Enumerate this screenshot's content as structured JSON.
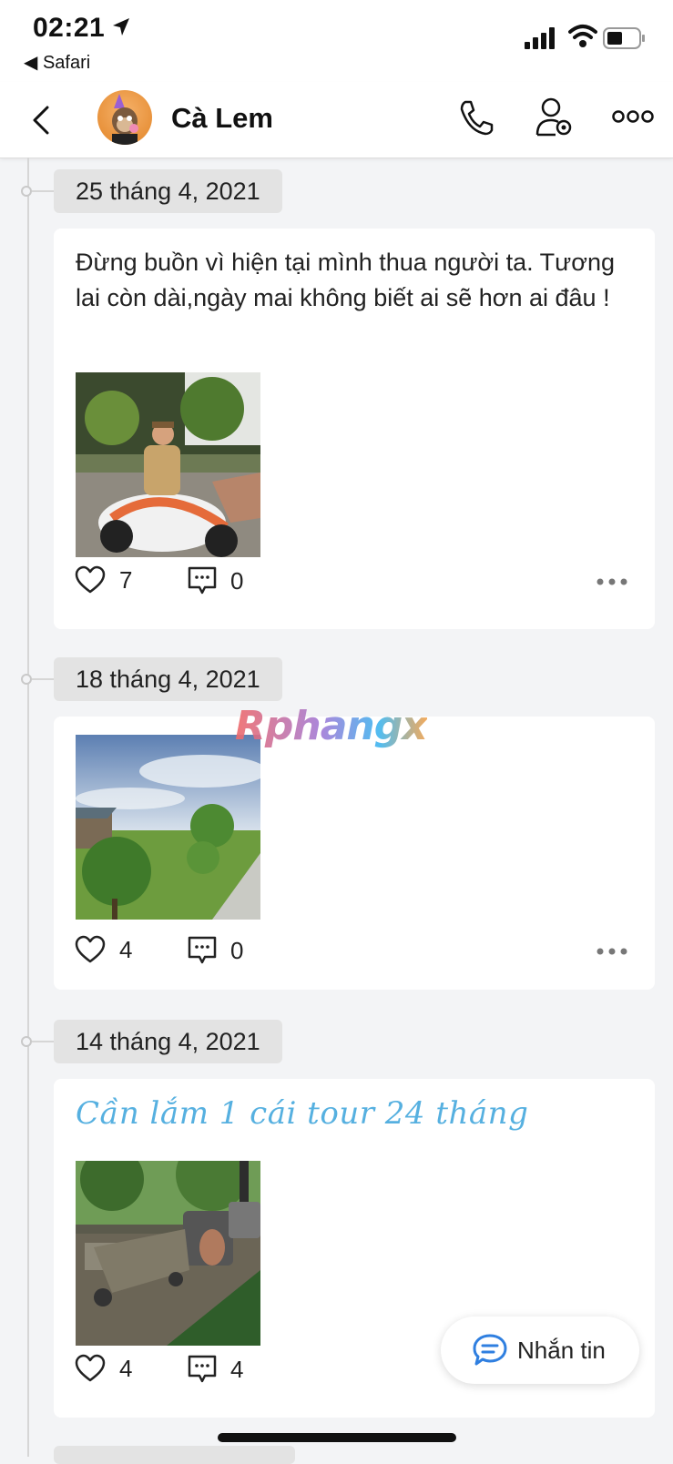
{
  "status_bar": {
    "time": "02:21",
    "back_app": "◀ Safari"
  },
  "header": {
    "name": "Cà Lem"
  },
  "watermark": "Rphangx",
  "posts": [
    {
      "date": "25 tháng 4, 2021",
      "text": "Đừng buồn vì hiện tại mình thua người ta. Tương lai còn dài,ngày mai không biết ai sẽ hơn ai đâu !",
      "likes": "7",
      "comments": "0"
    },
    {
      "date": "18 tháng 4, 2021",
      "likes": "4",
      "comments": "0"
    },
    {
      "date": "14 tháng 4, 2021",
      "text": "Cần lắm 1 cái tour 24 tháng",
      "likes": "4",
      "comments": "4"
    }
  ],
  "fab": {
    "label": "Nhắn tin"
  },
  "colors": {
    "accent": "#56b0e0",
    "background": "#f3f4f6"
  }
}
